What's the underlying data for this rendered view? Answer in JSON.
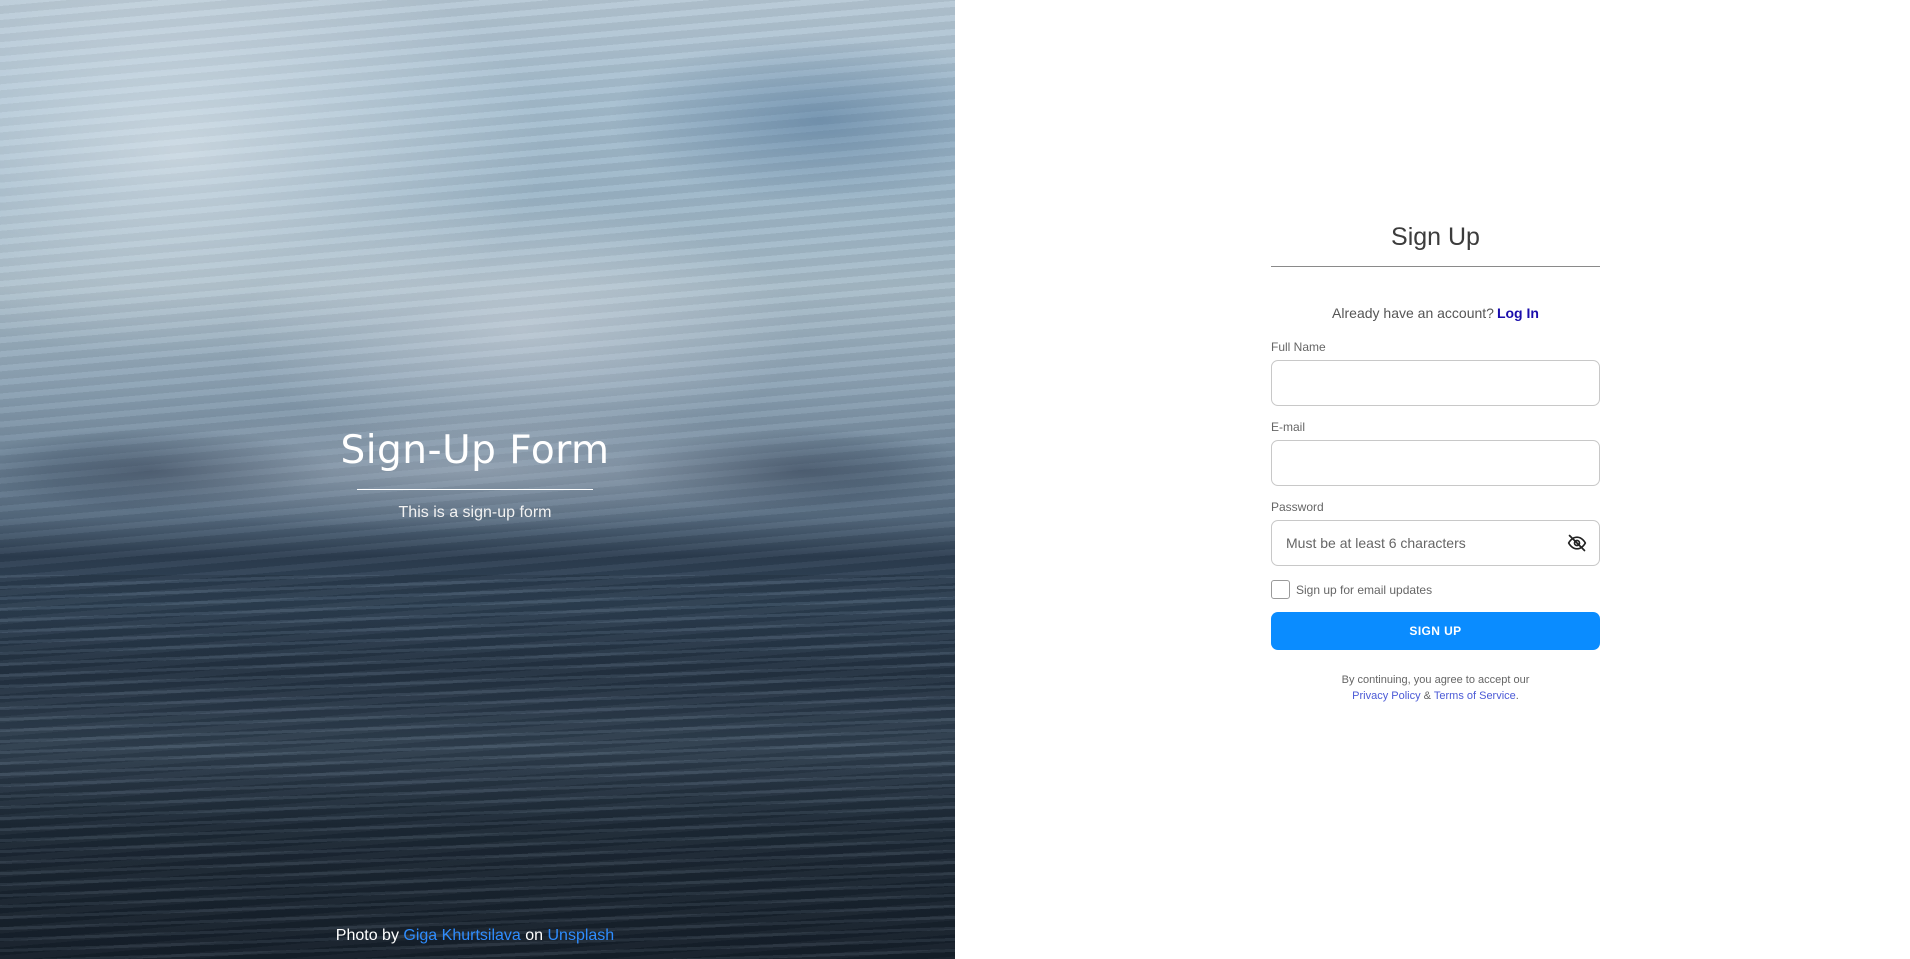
{
  "hero": {
    "title": "Sign-Up Form",
    "subtitle": "This is a sign-up form",
    "credit": {
      "prefix": "Photo by ",
      "author": "Giga Khurtsilava",
      "middle": " on ",
      "site": "Unsplash"
    }
  },
  "form": {
    "title": "Sign Up",
    "login_prompt": "Already have an account?",
    "login_link": "Log In",
    "fields": {
      "full_name": {
        "label": "Full Name",
        "value": "",
        "placeholder": ""
      },
      "email": {
        "label": "E-mail",
        "value": "",
        "placeholder": ""
      },
      "password": {
        "label": "Password",
        "value": "",
        "placeholder": "Must be at least 6 characters",
        "toggle_icon": "eye-slash-icon"
      }
    },
    "checkbox": {
      "label": "Sign up for email updates",
      "checked": false
    },
    "submit_label": "SIGN UP",
    "legal": {
      "line1": "By continuing, you agree to accept our",
      "privacy": "Privacy Policy",
      "and": " & ",
      "terms": "Terms of Service",
      "end": "."
    }
  },
  "colors": {
    "accent": "#0a8cff",
    "link": "#1a0dab",
    "credit_link": "#2f8dff",
    "legal_link": "#4b5ad6"
  }
}
